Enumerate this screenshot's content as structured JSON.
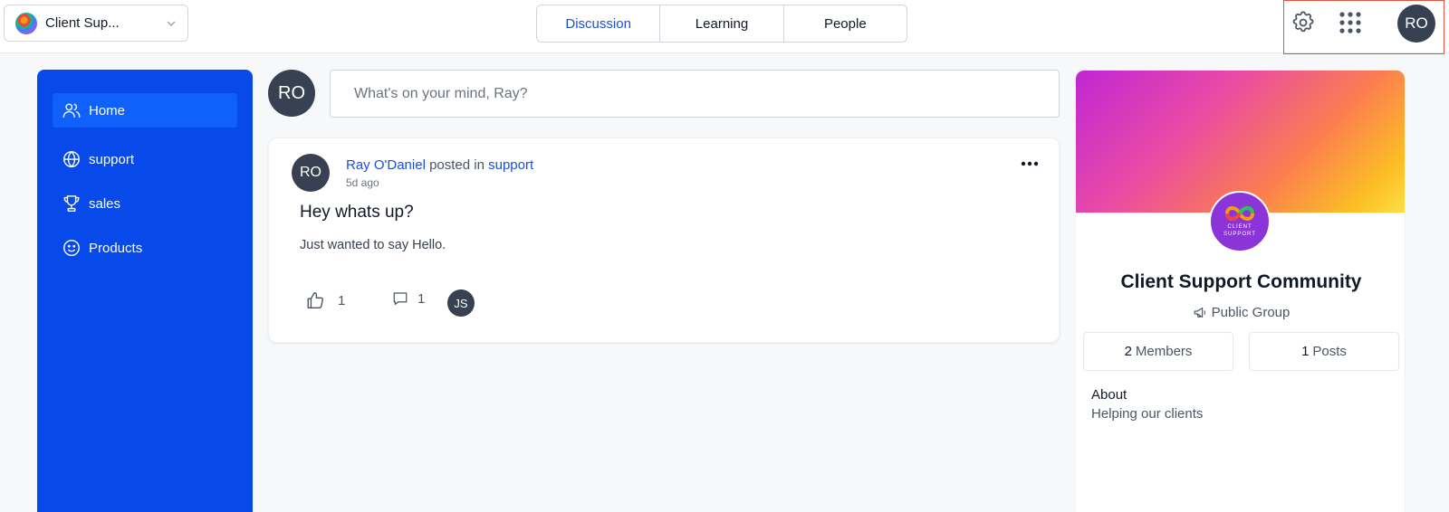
{
  "header": {
    "community_name": "Client Sup...",
    "tabs": [
      {
        "label": "Discussion",
        "active": true
      },
      {
        "label": "Learning",
        "active": false
      },
      {
        "label": "People",
        "active": false
      }
    ],
    "user_initials": "RO",
    "icons": [
      "gear-icon",
      "apps-grid-icon"
    ],
    "highlight_color": "#e0533d"
  },
  "sidebar": {
    "background": "#0849ea",
    "items": [
      {
        "label": "Home",
        "icon": "users-icon",
        "active": true
      },
      {
        "label": "support",
        "icon": "globe-icon",
        "active": false
      },
      {
        "label": "sales",
        "icon": "trophy-icon",
        "active": false
      },
      {
        "label": "Products",
        "icon": "smiley-icon",
        "active": false
      }
    ]
  },
  "composer": {
    "avatar_initials": "RO",
    "placeholder": "What's on your mind, Ray?"
  },
  "post": {
    "author_initials": "RO",
    "author": "Ray O'Daniel",
    "posted_in_text": " posted in ",
    "channel": "support",
    "time": "5d ago",
    "title": "Hey whats up?",
    "body": "Just wanted to say Hello.",
    "likes": "1",
    "comments": "1",
    "reactor_initials": "JS"
  },
  "group": {
    "name": "Client Support Community",
    "type": "Public Group",
    "logo_text_1": "CLIENT",
    "logo_text_2": "SUPPORT",
    "members_count": "2",
    "members_label": "Members",
    "posts_count": "1",
    "posts_label": "Posts",
    "about_heading": "About",
    "about_text": "Helping our clients"
  }
}
